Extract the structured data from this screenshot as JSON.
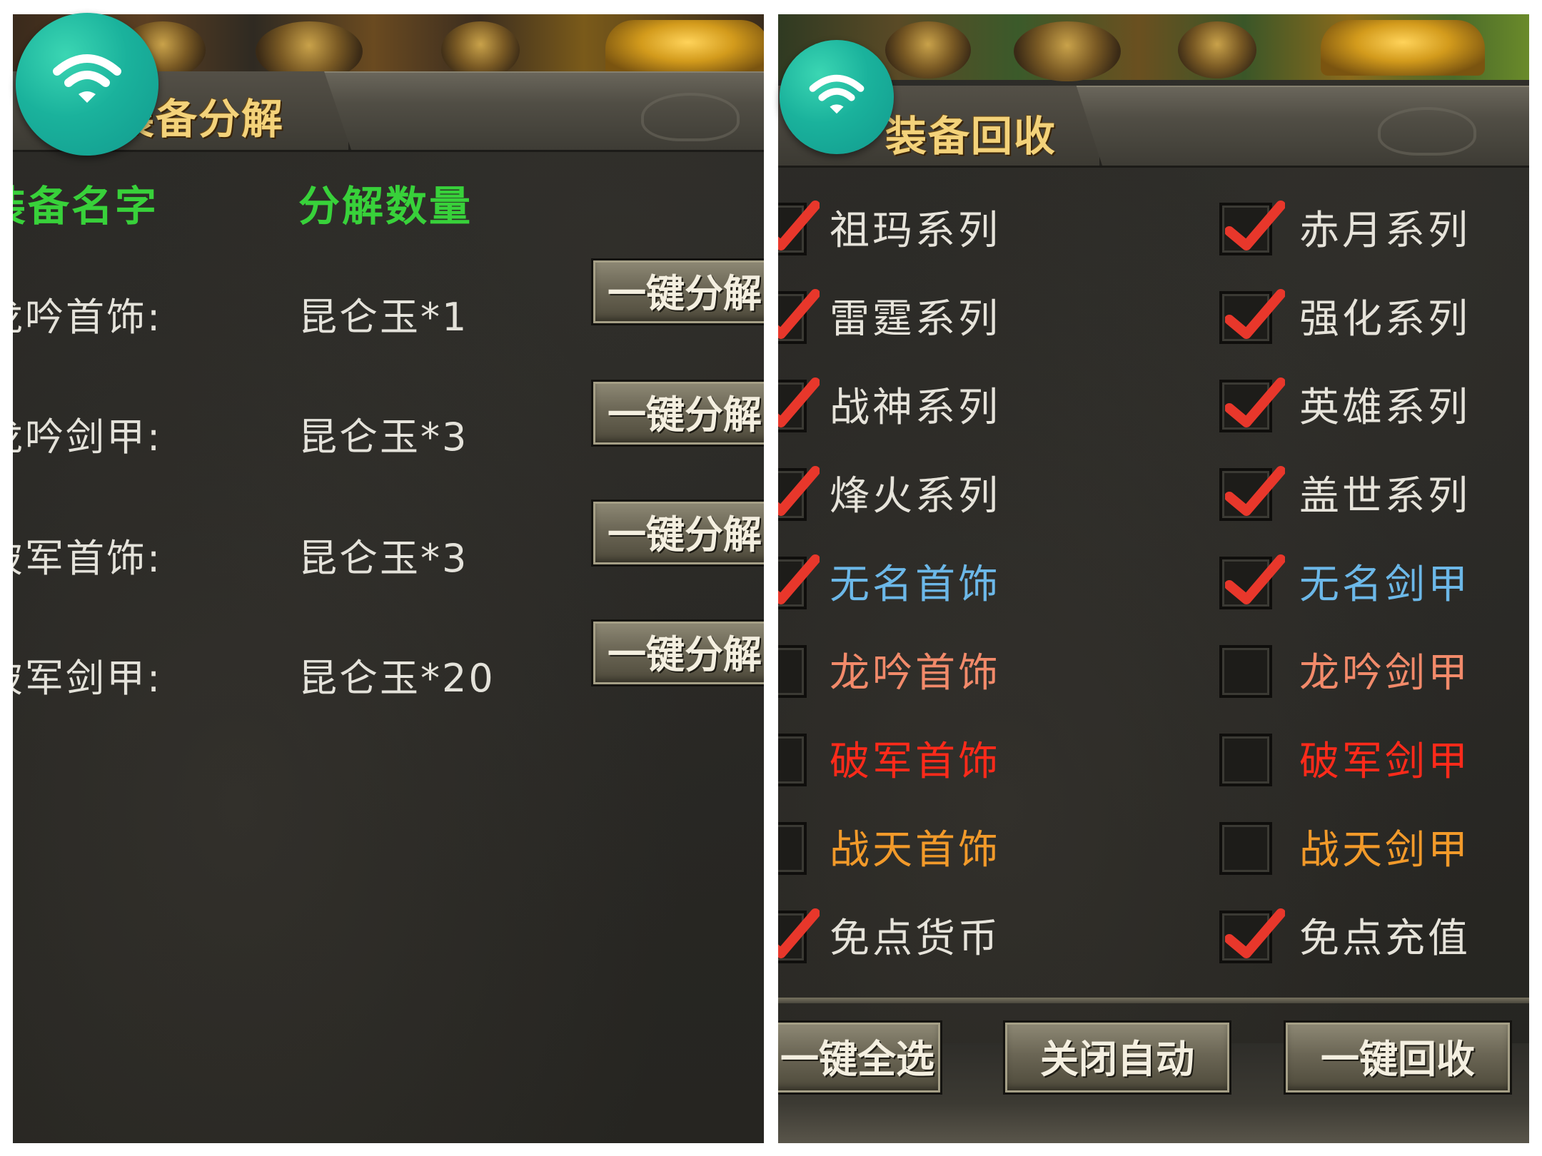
{
  "left_panel": {
    "title": "装备分解",
    "header_name": "装备名字",
    "header_count": "分解数量",
    "rows": [
      {
        "name": "龙吟首饰:",
        "count": "昆仑玉*1",
        "button": "一键分解"
      },
      {
        "name": "龙吟剑甲:",
        "count": "昆仑玉*3",
        "button": "一键分解"
      },
      {
        "name": "破军首饰:",
        "count": "昆仑玉*3",
        "button": "一键分解"
      },
      {
        "name": "破军剑甲:",
        "count": "昆仑玉*20",
        "button": "一键分解"
      }
    ]
  },
  "right_panel": {
    "title": "装备回收",
    "items": [
      {
        "label": "祖玛系列",
        "checked": true,
        "color": "#e6e3da"
      },
      {
        "label": "赤月系列",
        "checked": true,
        "color": "#e6e3da"
      },
      {
        "label": "雷霆系列",
        "checked": true,
        "color": "#e6e3da"
      },
      {
        "label": "强化系列",
        "checked": true,
        "color": "#e6e3da"
      },
      {
        "label": "战神系列",
        "checked": true,
        "color": "#e6e3da"
      },
      {
        "label": "英雄系列",
        "checked": true,
        "color": "#e6e3da"
      },
      {
        "label": "烽火系列",
        "checked": true,
        "color": "#e6e3da"
      },
      {
        "label": "盖世系列",
        "checked": true,
        "color": "#e6e3da"
      },
      {
        "label": "无名首饰",
        "checked": true,
        "color": "#6cb8e8"
      },
      {
        "label": "无名剑甲",
        "checked": true,
        "color": "#6cb8e8"
      },
      {
        "label": "龙吟首饰",
        "checked": false,
        "color": "#f28a6a"
      },
      {
        "label": "龙吟剑甲",
        "checked": false,
        "color": "#f28a6a"
      },
      {
        "label": "破军首饰",
        "checked": false,
        "color": "#ff2a1a"
      },
      {
        "label": "破军剑甲",
        "checked": false,
        "color": "#ff2a1a"
      },
      {
        "label": "战天首饰",
        "checked": false,
        "color": "#f29a2a"
      },
      {
        "label": "战天剑甲",
        "checked": false,
        "color": "#f29a2a"
      },
      {
        "label": "免点货币",
        "checked": true,
        "color": "#e6e3da"
      },
      {
        "label": "免点充值",
        "checked": true,
        "color": "#e6e3da"
      }
    ],
    "buttons": {
      "select_all": "一键全选",
      "close_auto": "关闭自动",
      "recycle": "一键回收"
    }
  },
  "colors": {
    "header_green": "#38d13a",
    "check_red": "#e8372b",
    "title_gold": "#f3d27a",
    "wifi_teal": "#1ab29c"
  },
  "icons": [
    "wifi-icon",
    "checkmark-icon"
  ]
}
